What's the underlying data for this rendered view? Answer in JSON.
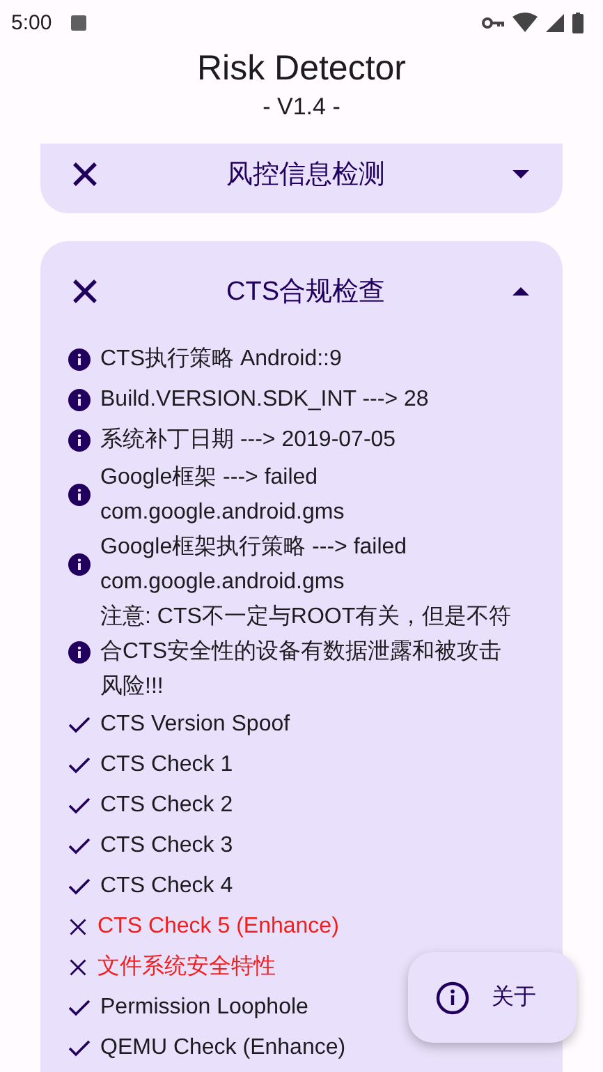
{
  "status_bar": {
    "time": "5:00"
  },
  "app": {
    "title": "Risk Detector",
    "version": "- V1.4 -"
  },
  "sections": [
    {
      "title": "风控信息检测",
      "expanded": false
    },
    {
      "title": "CTS合规检查",
      "expanded": true,
      "items": [
        {
          "kind": "info",
          "text": "CTS执行策略 Android::9"
        },
        {
          "kind": "info",
          "text": "Build.VERSION.SDK_INT ---> 28"
        },
        {
          "kind": "info",
          "text": "系统补丁日期 ---> 2019-07-05"
        },
        {
          "kind": "info",
          "text": "Google框架 ---> failed\ncom.google.android.gms"
        },
        {
          "kind": "info",
          "text": "Google框架执行策略 ---> failed\ncom.google.android.gms"
        },
        {
          "kind": "info",
          "text": "注意: CTS不一定与ROOT有关，但是不符合CTS安全性的设备有数据泄露和被攻击风险!!!"
        },
        {
          "kind": "check",
          "passed": true,
          "text": "CTS Version Spoof"
        },
        {
          "kind": "check",
          "passed": true,
          "text": "CTS Check 1"
        },
        {
          "kind": "check",
          "passed": true,
          "text": "CTS Check 2"
        },
        {
          "kind": "check",
          "passed": true,
          "text": "CTS Check 3"
        },
        {
          "kind": "check",
          "passed": true,
          "text": "CTS Check 4"
        },
        {
          "kind": "check",
          "passed": false,
          "text": "CTS Check 5 (Enhance)"
        },
        {
          "kind": "check",
          "passed": false,
          "text": "文件系统安全特性"
        },
        {
          "kind": "check",
          "passed": true,
          "text": "Permission Loophole"
        },
        {
          "kind": "check",
          "passed": true,
          "text": "QEMU Check (Enhance)"
        }
      ]
    }
  ],
  "fab": {
    "label": "关于"
  }
}
